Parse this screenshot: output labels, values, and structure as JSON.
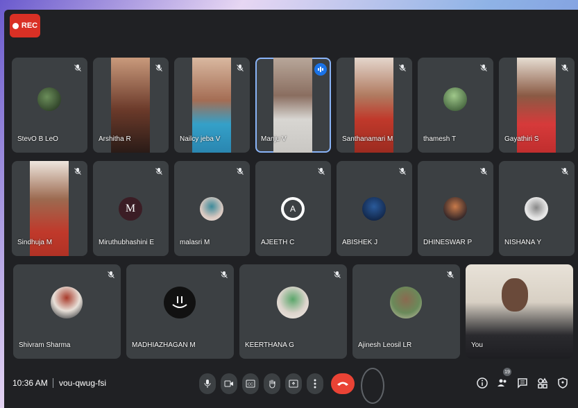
{
  "recording": {
    "label": "REC"
  },
  "participants": [
    {
      "name": "StevO B LeO",
      "muted": true
    },
    {
      "name": "Arshitha R",
      "muted": true
    },
    {
      "name": "Nailcy jeba V",
      "muted": true
    },
    {
      "name": "Manju V",
      "muted": false,
      "speaking": true
    },
    {
      "name": "Santhanamari M",
      "muted": true
    },
    {
      "name": "thamesh T",
      "muted": true
    },
    {
      "name": "Gayathiri S",
      "muted": true
    },
    {
      "name": "Sindhuja M",
      "muted": true
    },
    {
      "name": "Miruthubhashini E",
      "muted": true,
      "initial": "M"
    },
    {
      "name": "malasri M",
      "muted": true
    },
    {
      "name": "AJEETH C",
      "muted": true,
      "initial": "A"
    },
    {
      "name": "ABISHEK J",
      "muted": true
    },
    {
      "name": "DHINESWAR P",
      "muted": true
    },
    {
      "name": "NISHANA Y",
      "muted": true
    },
    {
      "name": "Shivram Sharma",
      "muted": true
    },
    {
      "name": "MADHIAZHAGAN M",
      "muted": true
    },
    {
      "name": "KEERTHANA G",
      "muted": true
    },
    {
      "name": "Ajinesh Leosil LR",
      "muted": true
    },
    {
      "name": "You",
      "muted": false
    }
  ],
  "footer": {
    "time": "10:36 AM",
    "meeting_code": "vou-qwug-fsi",
    "people_count": "19"
  },
  "colors": {
    "accent": "#8ab4f8",
    "end_call": "#ea4335",
    "rec": "#d93025",
    "tile": "#3c4043",
    "background": "#202124"
  }
}
